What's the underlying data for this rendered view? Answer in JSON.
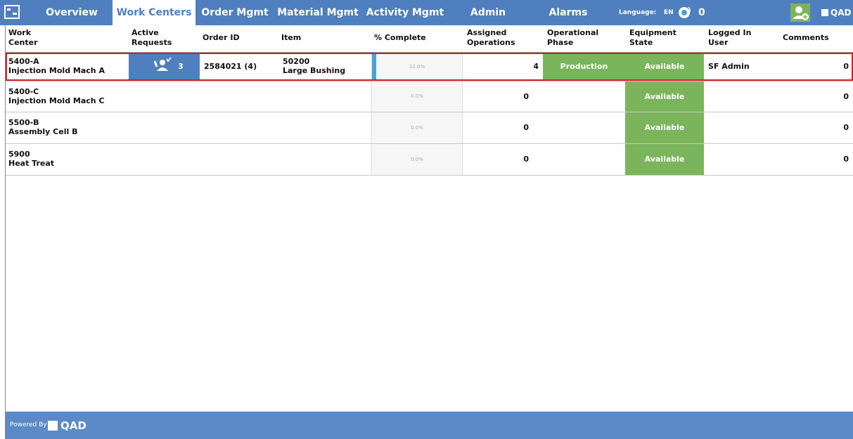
{
  "nav": {
    "tabs": [
      "Overview",
      "Work Centers",
      "Order Mgmt",
      "Material Mgmt",
      "Activity Mgmt",
      "Admin",
      "Alarms"
    ],
    "active": "Work Centers",
    "language_label": "Language:",
    "language_value": "EN",
    "alarm_count": "0",
    "brand": "QAD"
  },
  "table": {
    "headers": {
      "work_center": [
        "Work",
        "Center"
      ],
      "active_requests": [
        "Active",
        "Requests"
      ],
      "order_id": "Order ID",
      "item": "Item",
      "pct_complete": "% Complete",
      "assigned_operations": [
        "Assigned",
        "Operations"
      ],
      "operational_phase": [
        "Operational",
        "Phase"
      ],
      "equipment_state": [
        "Equipment",
        "State"
      ],
      "logged_in_user": [
        "Logged In",
        "User"
      ],
      "comments": "Comments"
    },
    "rows": [
      {
        "wc_code": "5400-A",
        "wc_name": "Injection Mold Mach A",
        "requests": "3",
        "order_id": "2584021 (4)",
        "item_code": "50200",
        "item_name": "Large Bushing",
        "pct": "12.0%",
        "pct_value": 0.12,
        "assigned": "4",
        "phase": "Production",
        "state": "Available",
        "user": "SF Admin",
        "comments": "0"
      },
      {
        "wc_code": "5400-C",
        "wc_name": "Injection Mold Mach C",
        "requests": "",
        "order_id": "",
        "item_code": "",
        "item_name": "",
        "pct": "0.0%",
        "pct_value": 0,
        "assigned": "0",
        "phase": "",
        "state": "Available",
        "user": "",
        "comments": "0"
      },
      {
        "wc_code": "5500-B",
        "wc_name": "Assembly Cell B",
        "requests": "",
        "order_id": "",
        "item_code": "",
        "item_name": "",
        "pct": "0.0%",
        "pct_value": 0,
        "assigned": "0",
        "phase": "",
        "state": "Available",
        "user": "",
        "comments": "0"
      },
      {
        "wc_code": "5900",
        "wc_name": "Heat Treat",
        "requests": "",
        "order_id": "",
        "item_code": "",
        "item_name": "",
        "pct": "0.0%",
        "pct_value": 0,
        "assigned": "0",
        "phase": "",
        "state": "Available",
        "user": "",
        "comments": "0"
      }
    ]
  },
  "footer": {
    "powered_by": "Powered By",
    "brand": "QAD"
  },
  "colors": {
    "nav": "#4f7fbe",
    "available": "#7ab55c",
    "selected_outline": "#d32026",
    "progress": "#4da0d8"
  }
}
